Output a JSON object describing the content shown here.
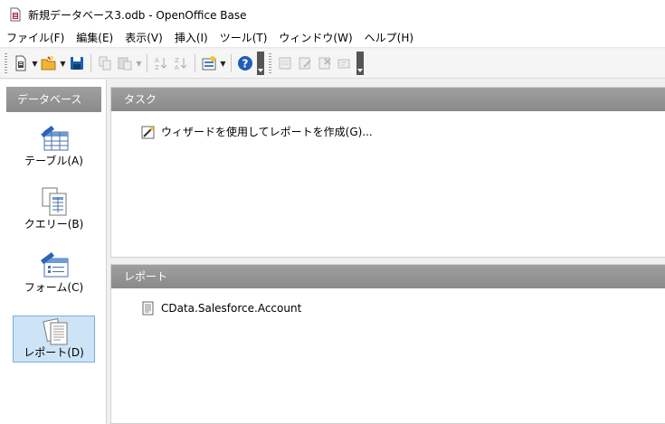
{
  "window": {
    "title": "新規データベース3.odb - OpenOffice Base",
    "app_icon": "database-document-icon"
  },
  "menu": [
    {
      "name": "menu-file",
      "label": "ファイル(F)"
    },
    {
      "name": "menu-edit",
      "label": "編集(E)"
    },
    {
      "name": "menu-view",
      "label": "表示(V)"
    },
    {
      "name": "menu-insert",
      "label": "挿入(I)"
    },
    {
      "name": "menu-tools",
      "label": "ツール(T)"
    },
    {
      "name": "menu-window",
      "label": "ウィンドウ(W)"
    },
    {
      "name": "menu-help",
      "label": "ヘルプ(H)"
    }
  ],
  "toolbar_icons": [
    "new-icon",
    "open-icon",
    "save-icon",
    "copy-icon",
    "paste-icon",
    "sort-ascending-icon",
    "sort-descending-icon",
    "form-icon",
    "help-icon",
    "open-object-icon",
    "edit-icon",
    "delete-icon",
    "rename-icon"
  ],
  "sidebar": {
    "header": "データベース",
    "items": [
      {
        "label": "テーブル(A)",
        "icon": "table-icon",
        "selected": false
      },
      {
        "label": "クエリー(B)",
        "icon": "query-icon",
        "selected": false
      },
      {
        "label": "フォーム(C)",
        "icon": "form-icon",
        "selected": false
      },
      {
        "label": "レポート(D)",
        "icon": "report-icon",
        "selected": true
      }
    ]
  },
  "tasks": {
    "header": "タスク",
    "items": [
      {
        "label": "ウィザードを使用してレポートを作成(G)...",
        "icon": "wizard-icon"
      }
    ]
  },
  "reports": {
    "header": "レポート",
    "items": [
      {
        "label": "CData.Salesforce.Account",
        "icon": "report-document-icon"
      }
    ]
  },
  "colors": {
    "header_bg": "#8f8f8f",
    "selection_bg": "#cde4f7",
    "selection_border": "#78aee0",
    "help_blue": "#1f5fb5"
  }
}
